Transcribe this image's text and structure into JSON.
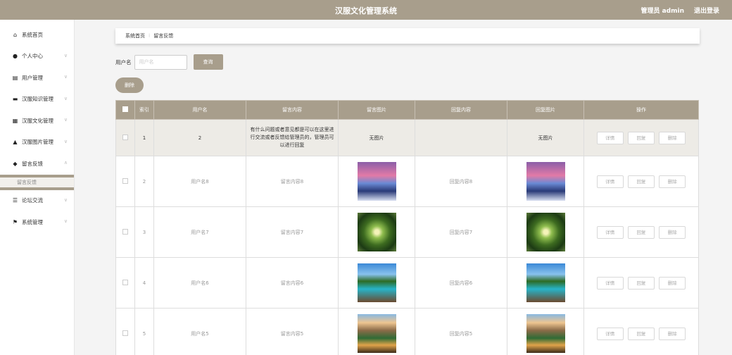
{
  "app": {
    "title": "汉服文化管理系统",
    "admin_label": "管理员 admin",
    "logout_label": "退出登录"
  },
  "sidebar": {
    "items": [
      {
        "label": "系统首页",
        "icon": "home-icon"
      },
      {
        "label": "个人中心",
        "icon": "user-icon"
      },
      {
        "label": "用户管理",
        "icon": "clipboard-icon"
      },
      {
        "label": "汉服知识管理",
        "icon": "comment-icon"
      },
      {
        "label": "汉服文化管理",
        "icon": "grid-icon"
      },
      {
        "label": "汉服图片管理",
        "icon": "bank-icon"
      },
      {
        "label": "留言反馈",
        "icon": "pin-icon"
      },
      {
        "label": "论坛交流",
        "icon": "list-icon"
      },
      {
        "label": "系统管理",
        "icon": "flag-icon"
      }
    ],
    "submenu_active": "留言反馈"
  },
  "breadcrumb": {
    "home": "系统首页",
    "separator": "⁝",
    "current": "留言反馈"
  },
  "search": {
    "label": "用户名",
    "placeholder": "用户名",
    "button": "查询"
  },
  "delete_button": "删除",
  "table": {
    "headers": [
      "索引",
      "用户名",
      "留言内容",
      "留言图片",
      "回复内容",
      "回复图片",
      "操作"
    ],
    "rows": [
      {
        "index": "1",
        "username": "2",
        "content": "有什么问题或者意见都是可以在这里进行交流或者反馈给管理员的，管理员可以进行回复",
        "image_text": "无图片",
        "reply": "",
        "reply_image_text": "无图片",
        "actions": [
          "详情",
          "回复",
          "删除"
        ]
      },
      {
        "index": "2",
        "username": "用户名8",
        "content": "留言内容8",
        "image": "winter-sunset",
        "reply": "回复内容8",
        "reply_image": "winter-sunset",
        "actions": [
          "详情",
          "回复",
          "删除"
        ]
      },
      {
        "index": "3",
        "username": "用户名7",
        "content": "留言内容7",
        "image": "forest-canopy",
        "reply": "回复内容7",
        "reply_image": "forest-canopy",
        "actions": [
          "详情",
          "回复",
          "删除"
        ]
      },
      {
        "index": "4",
        "username": "用户名6",
        "content": "留言内容6",
        "image": "lake-pier",
        "reply": "回复内容6",
        "reply_image": "lake-pier",
        "actions": [
          "详情",
          "回复",
          "删除"
        ]
      },
      {
        "index": "5",
        "username": "用户名5",
        "content": "留言内容5",
        "image": "mountain-lake",
        "reply": "回复内容5",
        "reply_image": "mountain-lake",
        "actions": [
          "详情",
          "回复",
          "删除"
        ]
      }
    ]
  },
  "colors": {
    "accent": "#a89e8c",
    "highlight_row": "#edebe6"
  }
}
